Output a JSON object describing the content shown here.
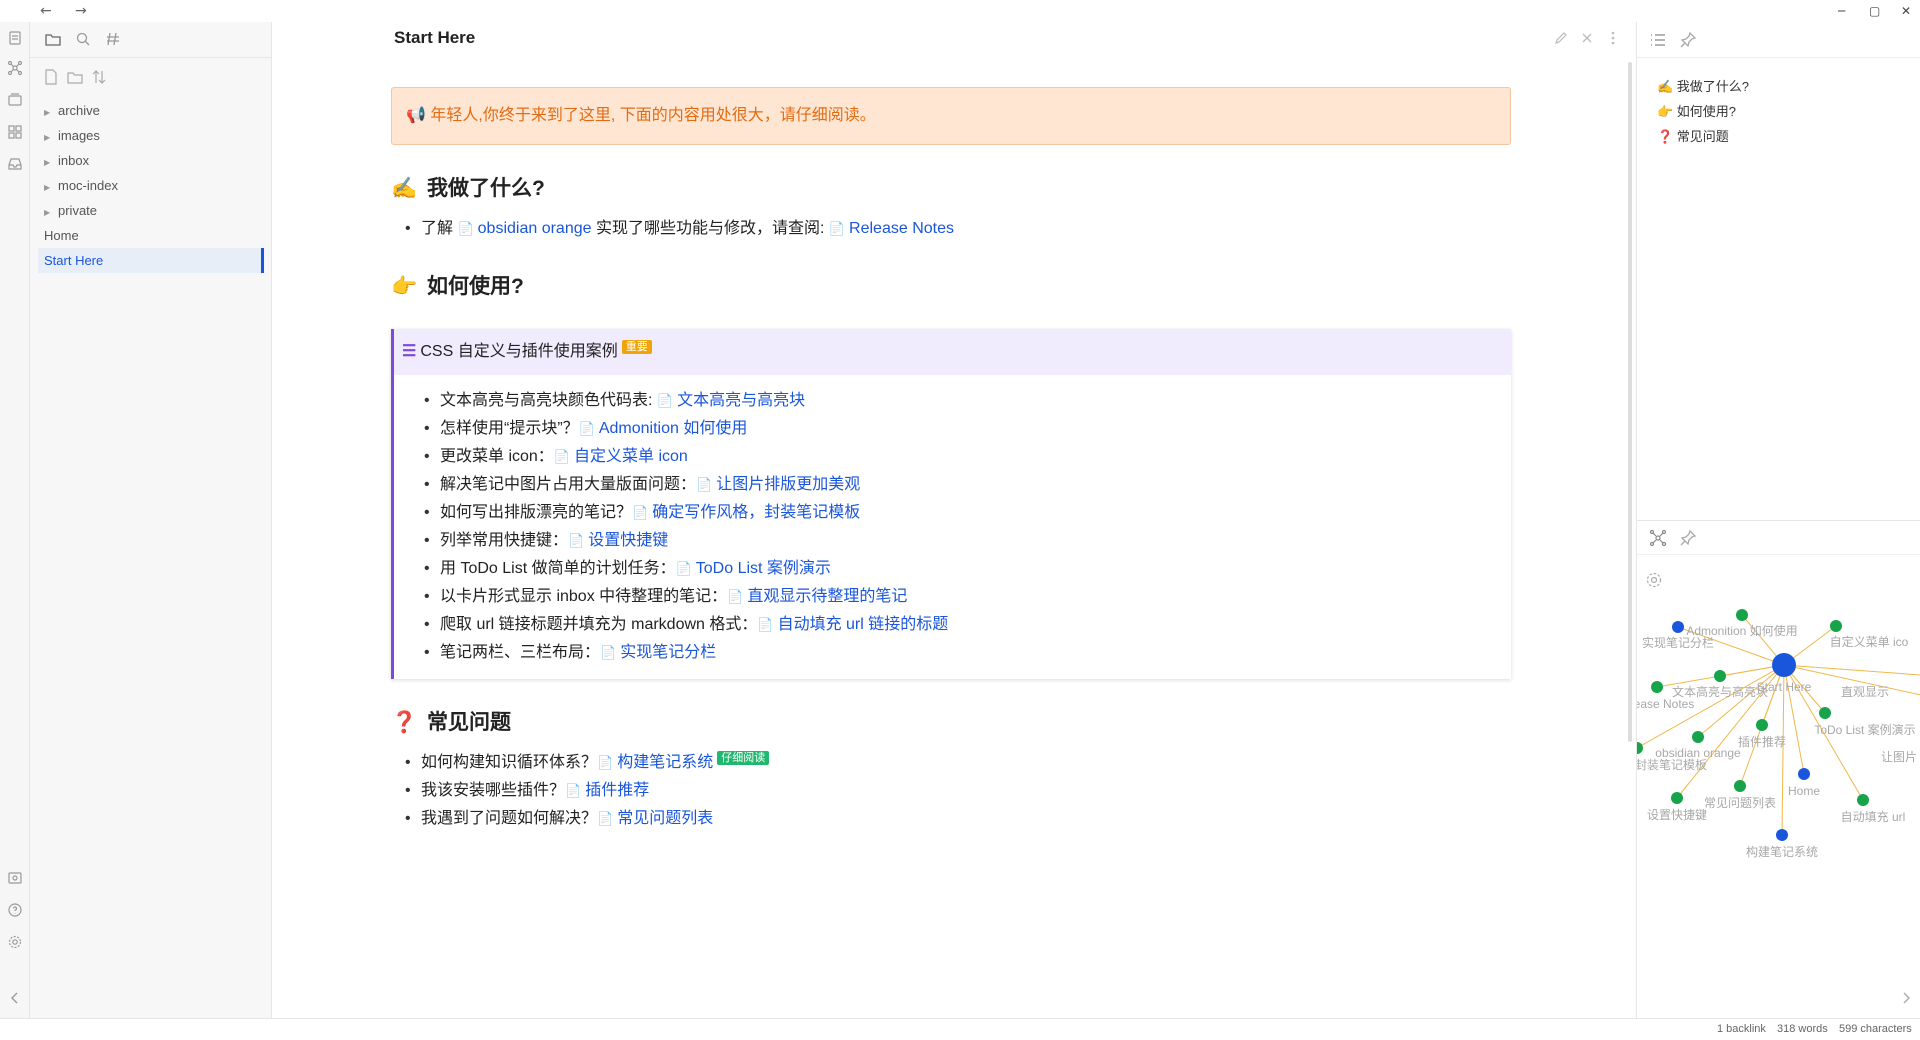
{
  "titlebar": {
    "back_icon": "arrow-left-icon",
    "forward_icon": "arrow-right-icon",
    "controls": [
      "minimize",
      "maximize",
      "close"
    ]
  },
  "left_sidebar": {
    "tree": [
      {
        "label": "archive",
        "folder": true
      },
      {
        "label": "images",
        "folder": true
      },
      {
        "label": "inbox",
        "folder": true
      },
      {
        "label": "moc-index",
        "folder": true
      },
      {
        "label": "private",
        "folder": true
      },
      {
        "label": "Home",
        "folder": false
      },
      {
        "label": "Start Here",
        "folder": false,
        "active": true
      }
    ]
  },
  "main": {
    "title": "Start Here",
    "banner": "📢 年轻人,你终于来到了这里, 下面的内容用处很大，请仔细阅读。",
    "sec1": {
      "emoji": "✍️",
      "heading": "我做了什么?",
      "item": {
        "pre": "了解 ",
        "link1": "obsidian orange",
        "mid": " 实现了哪些功能与修改，请查阅: ",
        "link2": "Release Notes"
      }
    },
    "sec2": {
      "emoji": "👉",
      "heading": "如何使用?"
    },
    "callout": {
      "title": "CSS 自定义与插件使用案例",
      "tag": "重要",
      "items": [
        {
          "text": "文本高亮与高亮块颜色代码表: ",
          "link": "文本高亮与高亮块"
        },
        {
          "text": "怎样使用“提示块”？",
          "link": "Admonition 如何使用"
        },
        {
          "text": "更改菜单 icon：",
          "link": "自定义菜单 icon"
        },
        {
          "text": "解决笔记中图片占用大量版面问题：",
          "link": "让图片排版更加美观"
        },
        {
          "text": "如何写出排版漂亮的笔记？",
          "link": "确定写作风格，封装笔记模板"
        },
        {
          "text": "列举常用快捷键：",
          "link": "设置快捷键"
        },
        {
          "text": "用 ToDo List 做简单的计划任务：",
          "link": "ToDo List 案例演示"
        },
        {
          "text": "以卡片形式显示 inbox 中待整理的笔记：",
          "link": "直观显示待整理的笔记"
        },
        {
          "text": "爬取 url 链接标题并填充为 markdown 格式：",
          "link": "自动填充 url 链接的标题"
        },
        {
          "text": "笔记两栏、三栏布局：",
          "link": "实现笔记分栏"
        }
      ]
    },
    "sec3": {
      "emoji": "❓",
      "heading": "常见问题",
      "items": [
        {
          "text": "如何构建知识循环体系？",
          "link": "构建笔记系统",
          "tag": "仔细阅读"
        },
        {
          "text": "我该安装哪些插件？",
          "link": "插件推荐"
        },
        {
          "text": "我遇到了问题如何解决？",
          "link": "常见问题列表"
        }
      ]
    }
  },
  "right_sidebar": {
    "outline": [
      "✍️ 我做了什么?",
      "👉 如何使用?",
      "❓ 常见问题"
    ],
    "graph_labels": {
      "center": "Start Here",
      "admonition": "Admonition 如何使用",
      "fenlan": "实现笔记分栏",
      "menu": "自定义菜单 ico",
      "highlight": "文本高亮与高亮块",
      "zhiguan": "直观显示",
      "release": "ease Notes",
      "todo": "ToDo List 案例演示",
      "plugins": "插件推荐",
      "orange": "obsidian orange",
      "template": "封装笔记模板",
      "image": "让图片",
      "home": "Home",
      "faq": "常见问题列表",
      "shortcut": "设置快捷键",
      "url": "自动填充 url",
      "system": "构建笔记系统"
    }
  },
  "statusbar": {
    "backlinks": "1 backlink",
    "words": "318 words",
    "chars": "599 characters"
  },
  "colors": {
    "accent": "#1a56db",
    "banner_bg": "#ffe6d2",
    "banner_text": "#e36b12",
    "callout_border": "#7b4ad9",
    "callout_bg": "#f0ebfd",
    "tag_important": "#f0a30a",
    "tag_read": "#1fb86e",
    "graph_green": "#16a34a",
    "graph_blue": "#1a56db"
  }
}
